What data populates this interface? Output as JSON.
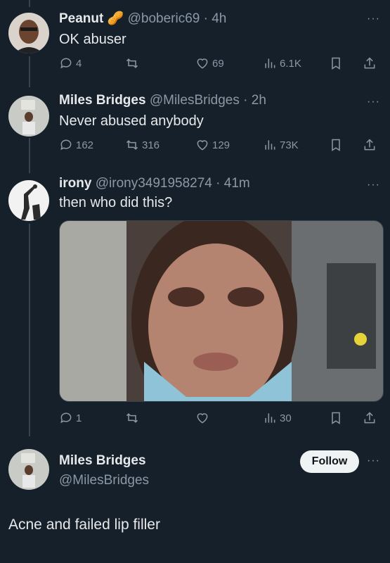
{
  "tweets": [
    {
      "name": "Peanut",
      "name_emoji": "🥜",
      "handle": "@boberic69",
      "sep": "·",
      "time": "4h",
      "text": "OK abuser",
      "replies": "4",
      "retweets": "",
      "likes": "69",
      "views": "6.1K"
    },
    {
      "name": "Miles Bridges",
      "handle": "@MilesBridges",
      "sep": "·",
      "time": "2h",
      "text": "Never abused anybody",
      "replies": "162",
      "retweets": "316",
      "likes": "129",
      "views": "73K"
    },
    {
      "name": "irony",
      "handle": "@irony3491958274",
      "sep": "·",
      "time": "41m",
      "text": "then who did this?",
      "replies": "1",
      "retweets": "",
      "likes": "",
      "views": "30"
    }
  ],
  "main": {
    "name": "Miles Bridges",
    "handle": "@MilesBridges",
    "follow_label": "Follow",
    "text": "Acne and failed lip filler"
  },
  "more_label": "···",
  "colors": {
    "background": "#15202b",
    "text": "#e7e9ea",
    "muted": "#8b98a5",
    "line": "#38444d"
  }
}
